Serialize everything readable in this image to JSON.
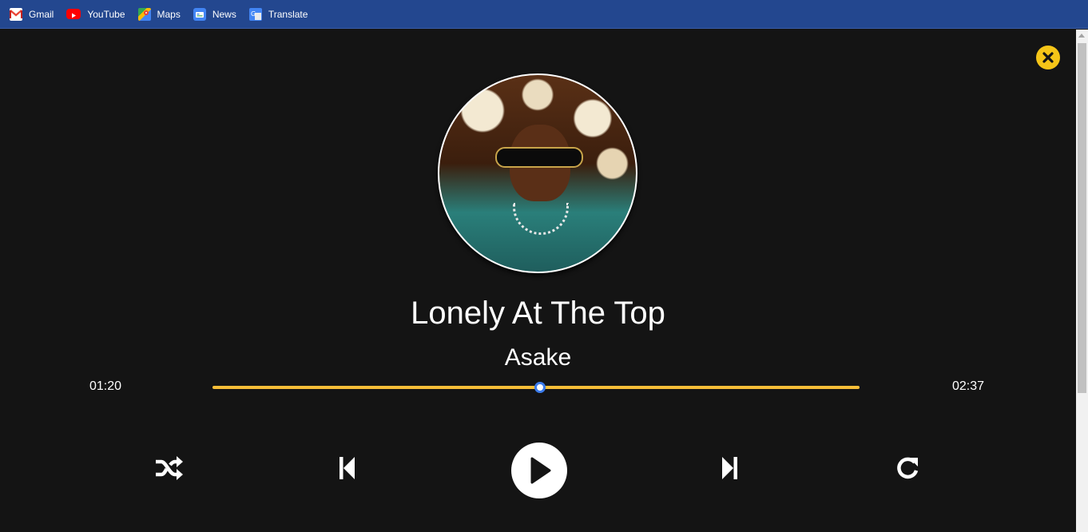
{
  "bookmarks": [
    {
      "label": "Gmail",
      "icon": "gmail-icon"
    },
    {
      "label": "YouTube",
      "icon": "youtube-icon"
    },
    {
      "label": "Maps",
      "icon": "maps-icon"
    },
    {
      "label": "News",
      "icon": "news-icon"
    },
    {
      "label": "Translate",
      "icon": "translate-icon"
    }
  ],
  "player": {
    "song_title": "Lonely At The Top",
    "artist": "Asake",
    "current_time": "01:20",
    "duration": "02:37",
    "progress_fraction": 0.506,
    "accent_color": "#f7be38",
    "close_button_color": "#f5c518",
    "knob_border_color": "#3b7bea",
    "background_color": "#141414",
    "controls": [
      "shuffle-icon",
      "previous-icon",
      "play-icon",
      "next-icon",
      "repeat-icon"
    ]
  }
}
